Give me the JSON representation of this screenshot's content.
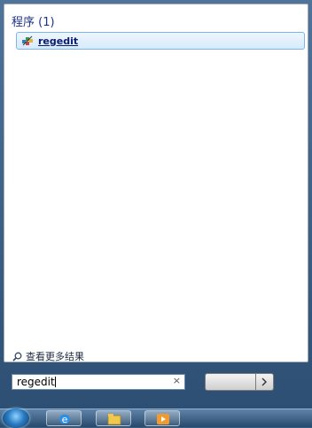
{
  "results": {
    "section_header": "程序 (1)",
    "items": [
      {
        "label": "regedit",
        "icon": "registry-editor-icon"
      }
    ]
  },
  "footer": {
    "more_results": "查看更多结果",
    "search_value": "regedit"
  },
  "icons": {
    "more_results": "search-icon",
    "clear": "close-icon"
  },
  "glyphs": {
    "clear": "×"
  },
  "taskbar": {
    "items": [
      {
        "name": "internet-explorer-icon"
      },
      {
        "name": "windows-explorer-icon"
      },
      {
        "name": "media-player-icon"
      }
    ]
  },
  "colors": {
    "accent_blue": "#1e3287",
    "selection_border": "#7eb4ea",
    "taskbar": "#3b5f82"
  }
}
